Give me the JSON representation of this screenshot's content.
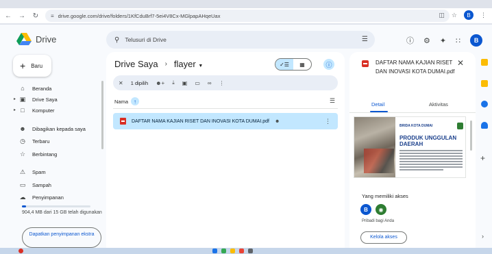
{
  "browser": {
    "url": "drive.google.com/drive/folders/1KfCduBrf7-5ei4V8Cx-MGlpapAHqeUax",
    "profile_initial": "B"
  },
  "drive": {
    "logo_text": "Drive",
    "search_placeholder": "Telusuri di Drive",
    "avatar_initial": "B",
    "new_button": "Baru"
  },
  "sidebar": {
    "items": [
      {
        "label": "Beranda",
        "icon": "home-icon"
      },
      {
        "label": "Drive Saya",
        "icon": "drive-icon"
      },
      {
        "label": "Komputer",
        "icon": "computer-icon"
      },
      {
        "label": "Dibagikan kepada saya",
        "icon": "shared-icon"
      },
      {
        "label": "Terbaru",
        "icon": "clock-icon"
      },
      {
        "label": "Berbintang",
        "icon": "star-icon"
      },
      {
        "label": "Spam",
        "icon": "spam-icon"
      },
      {
        "label": "Sampah",
        "icon": "trash-icon"
      },
      {
        "label": "Penyimpanan",
        "icon": "cloud-icon"
      }
    ],
    "storage_text": "904,4 MB dari 15 GB telah digunakan",
    "storage_used_fraction": 0.06,
    "get_more_label": "Dapatkan penyimpanan ekstra"
  },
  "main": {
    "breadcrumb_root": "Drive Saya",
    "breadcrumb_current": "flayer",
    "selection_count": "1 dipilih",
    "column_name": "Nama",
    "files": [
      {
        "name": "DAFTAR NAMA KAJIAN RISET DAN INOVASI KOTA DUMAI.pdf",
        "type": "pdf",
        "shared": true,
        "selected": true
      }
    ]
  },
  "details": {
    "title": "DAFTAR NAMA KAJIAN RISET DAN INOVASI KOTA DUMAI.pdf",
    "tab_detail": "Detail",
    "tab_activity": "Aktivitas",
    "thumb_head_small": "BRIDA KOTA DUMAI",
    "thumb_head_big": "PRODUK UNGGULAN DAERAH",
    "access_title": "Yang memiliki akses",
    "access_avatar": "B",
    "private_text": "Pribadi bagi Anda",
    "manage_button": "Kelola akses"
  },
  "colors": {
    "accent": "#0b57d0",
    "selected_row": "#c2e7ff",
    "pdf_red": "#d93025"
  }
}
